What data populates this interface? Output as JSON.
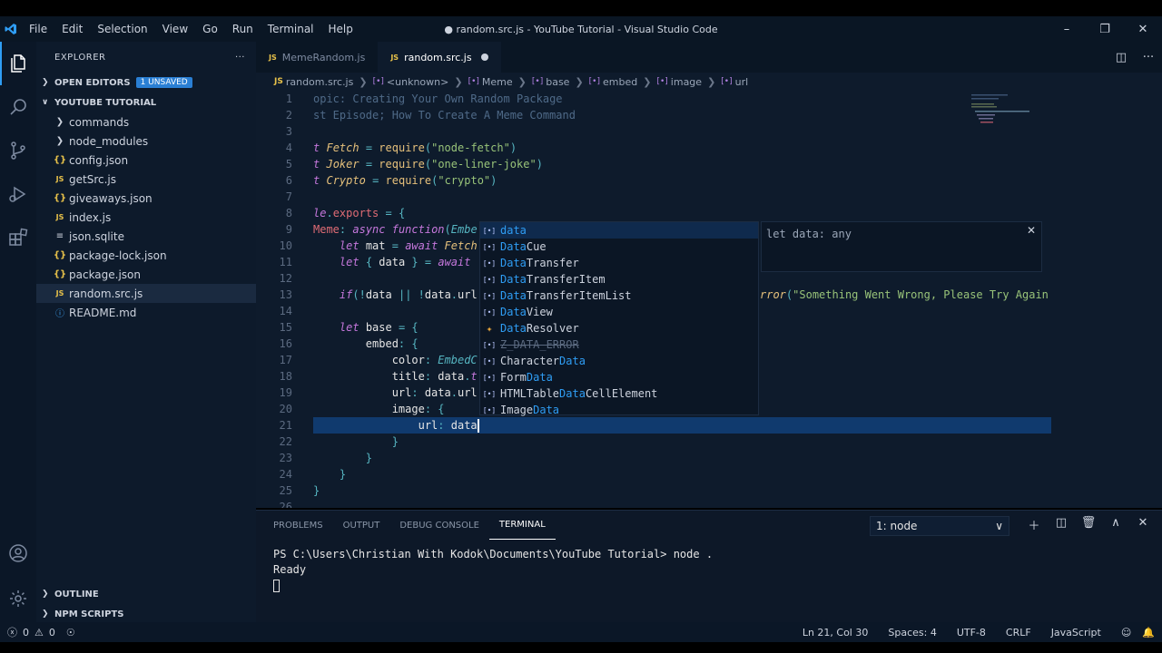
{
  "window": {
    "title": "● random.src.js - YouTube Tutorial - Visual Studio Code",
    "menu": [
      "File",
      "Edit",
      "Selection",
      "View",
      "Go",
      "Run",
      "Terminal",
      "Help"
    ]
  },
  "sidebar": {
    "title": "EXPLORER",
    "open_editors": {
      "label": "OPEN EDITORS",
      "badge": "1 UNSAVED"
    },
    "folder": "YOUTUBE TUTORIAL",
    "items": [
      {
        "label": "commands",
        "type": "folder"
      },
      {
        "label": "node_modules",
        "type": "folder"
      },
      {
        "label": "config.json",
        "type": "json"
      },
      {
        "label": "getSrc.js",
        "type": "js"
      },
      {
        "label": "giveaways.json",
        "type": "json"
      },
      {
        "label": "index.js",
        "type": "js"
      },
      {
        "label": "json.sqlite",
        "type": "db"
      },
      {
        "label": "package-lock.json",
        "type": "json"
      },
      {
        "label": "package.json",
        "type": "json"
      },
      {
        "label": "random.src.js",
        "type": "js",
        "selected": true
      },
      {
        "label": "README.md",
        "type": "info"
      }
    ],
    "outline": "OUTLINE",
    "npm_scripts": "NPM SCRIPTS"
  },
  "tabs": [
    {
      "label": "MemeRandom.js",
      "active": false
    },
    {
      "label": "random.src.js",
      "active": true,
      "dirty": true
    }
  ],
  "breadcrumb": [
    "random.src.js",
    "<unknown>",
    "Meme",
    "base",
    "embed",
    "image",
    "url"
  ],
  "editor": {
    "lines": [
      {
        "n": "1",
        "text": "opic: Creating Your Own Random Package"
      },
      {
        "n": "2",
        "text": "st Episode; How To Create A Meme Command"
      },
      {
        "n": "3",
        "text": ""
      },
      {
        "n": "4",
        "text": "t Fetch = require(\"node-fetch\")"
      },
      {
        "n": "5",
        "text": "t Joker = require(\"one-liner-joke\")"
      },
      {
        "n": "6",
        "text": "t Crypto = require(\"crypto\")"
      },
      {
        "n": "7",
        "text": ""
      },
      {
        "n": "8",
        "text": "le.exports = {"
      },
      {
        "n": "9",
        "text": "Meme: async function(Embe"
      },
      {
        "n": "10",
        "text": "    let mat = await Fetch"
      },
      {
        "n": "11",
        "text": "    let { data } = await"
      },
      {
        "n": "12",
        "text": ""
      },
      {
        "n": "13",
        "text": "    if(!data || !data.url",
        "tail": "rror(\"Something Went Wrong, Please Try Again"
      },
      {
        "n": "14",
        "text": ""
      },
      {
        "n": "15",
        "text": "    let base = {"
      },
      {
        "n": "16",
        "text": "        embed: {"
      },
      {
        "n": "17",
        "text": "            color: EmbedC"
      },
      {
        "n": "18",
        "text": "            title: data.t"
      },
      {
        "n": "19",
        "text": "            url: data.url"
      },
      {
        "n": "20",
        "text": "            image: {"
      },
      {
        "n": "21",
        "text": "                url: data"
      },
      {
        "n": "22",
        "text": "            }"
      },
      {
        "n": "23",
        "text": "        }"
      },
      {
        "n": "24",
        "text": "    }"
      },
      {
        "n": "25",
        "text": "}"
      },
      {
        "n": "26",
        "text": ""
      }
    ]
  },
  "suggest": {
    "items": [
      {
        "pre": "",
        "match": "data",
        "post": "",
        "icon": "var",
        "selected": true
      },
      {
        "pre": "",
        "match": "Data",
        "post": "Cue",
        "icon": "var"
      },
      {
        "pre": "",
        "match": "Data",
        "post": "Transfer",
        "icon": "var"
      },
      {
        "pre": "",
        "match": "Data",
        "post": "TransferItem",
        "icon": "var"
      },
      {
        "pre": "",
        "match": "Data",
        "post": "TransferItemList",
        "icon": "var"
      },
      {
        "pre": "",
        "match": "Data",
        "post": "View",
        "icon": "var"
      },
      {
        "pre": "",
        "match": "Data",
        "post": "Resolver",
        "icon": "class"
      },
      {
        "pre": "Z_DATA_ERROR",
        "match": "",
        "post": "",
        "icon": "var",
        "deprecated": true
      },
      {
        "pre": "Character",
        "match": "Data",
        "post": "",
        "icon": "var"
      },
      {
        "pre": "Form",
        "match": "Data",
        "post": "",
        "icon": "var"
      },
      {
        "pre": "HTMLTable",
        "match": "Data",
        "post": "CellElement",
        "icon": "var"
      },
      {
        "pre": "Image",
        "match": "Data",
        "post": "",
        "icon": "var"
      }
    ],
    "detail": "let data: any"
  },
  "panel": {
    "tabs": [
      "PROBLEMS",
      "OUTPUT",
      "DEBUG CONSOLE",
      "TERMINAL"
    ],
    "active_tab": "TERMINAL",
    "terminal_select": "1: node",
    "terminal_lines": [
      "PS C:\\Users\\Christian With Kodok\\Documents\\YouTube Tutorial> node .",
      "Ready"
    ]
  },
  "status": {
    "errors": "0",
    "warnings": "0",
    "position": "Ln 21, Col 30",
    "spaces": "Spaces: 4",
    "encoding": "UTF-8",
    "eol": "CRLF",
    "language": "JavaScript"
  },
  "colors": {
    "accent": "#2f9df4",
    "background": "#0e1b2c",
    "sidebar": "#0d1a2b",
    "selection": "#103a6e"
  }
}
